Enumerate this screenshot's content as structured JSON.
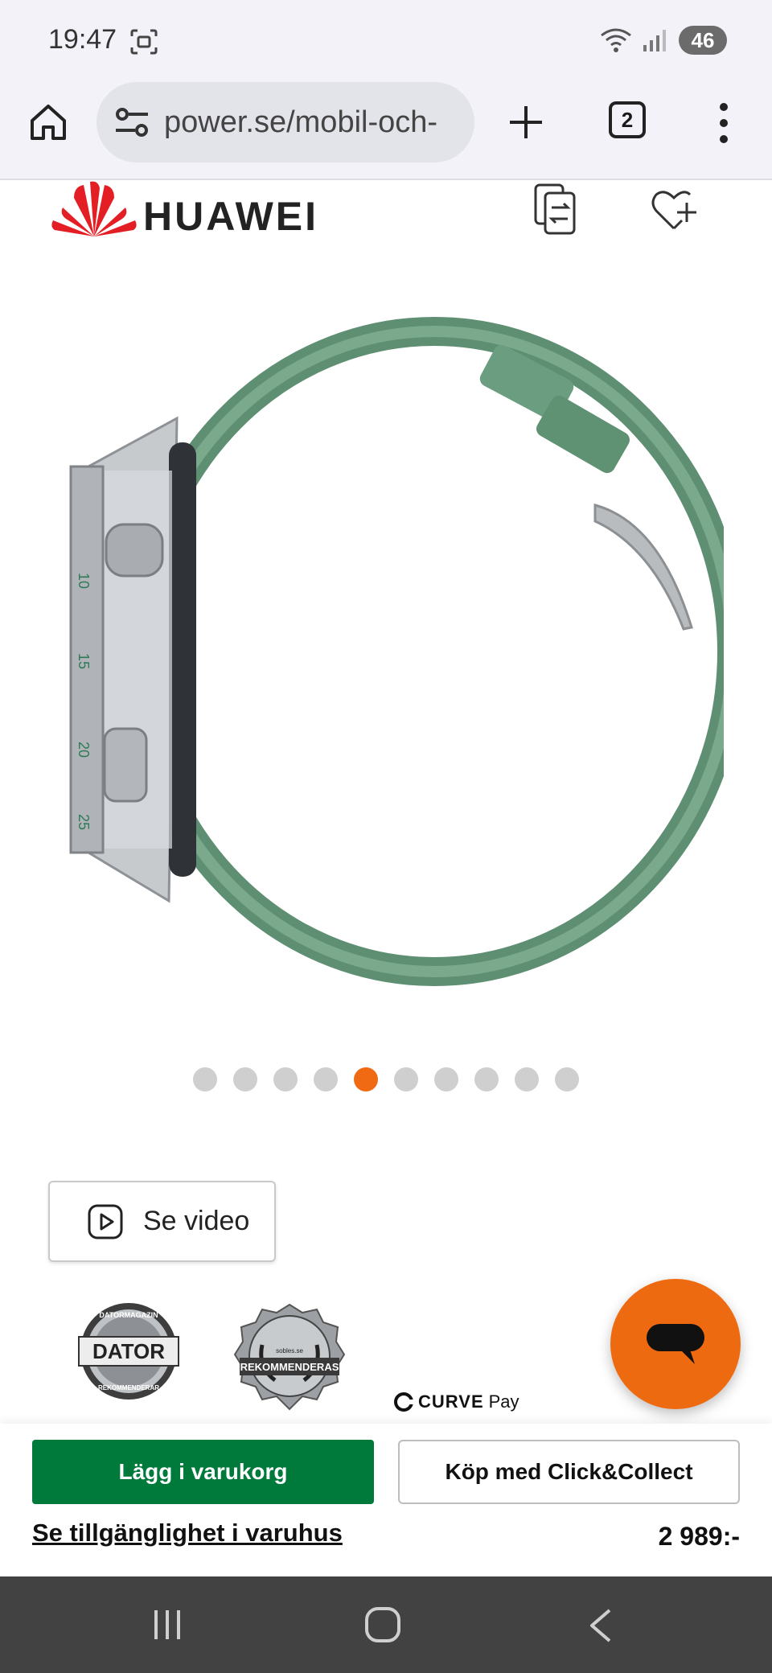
{
  "status_bar": {
    "time": "19:47",
    "battery": "46",
    "icons": [
      "screenshot-icon",
      "wifi-icon",
      "signal-icon"
    ]
  },
  "browser": {
    "url": "power.se/mobil-och-",
    "tab_count": "2",
    "icons": [
      "home-icon",
      "site-settings-icon",
      "plus-icon",
      "menu-dots-icon"
    ]
  },
  "site_header": {
    "brand": "HUAWEI",
    "icons": [
      "huawei-logo-icon",
      "compare-icon",
      "wishlist-icon"
    ]
  },
  "carousel": {
    "total": 10,
    "active_index": 4,
    "active_color": "#ef6a12",
    "inactive_color": "#cfcfcf"
  },
  "video_button": {
    "label": "Se video"
  },
  "badges": {
    "dator_logo_text": "DATOR",
    "dator_ring_top": "DATORMAGAZIN",
    "dator_ring_bottom": "REKOMMENDERAR",
    "rek_logo_text": "REKOMMENDERAS",
    "rek_small": "sobles.se",
    "curve_brand": "CURVE",
    "curve_suffix": "Pay"
  },
  "purchase": {
    "add_to_cart": "Lägg i varukorg",
    "click_collect": "Köp med Click&Collect",
    "store_availability": "Se tillgänglighet i varuhus",
    "price": "2 989:-",
    "primary_color": "#007a3b"
  },
  "chat": {
    "color": "#ee6a10"
  }
}
